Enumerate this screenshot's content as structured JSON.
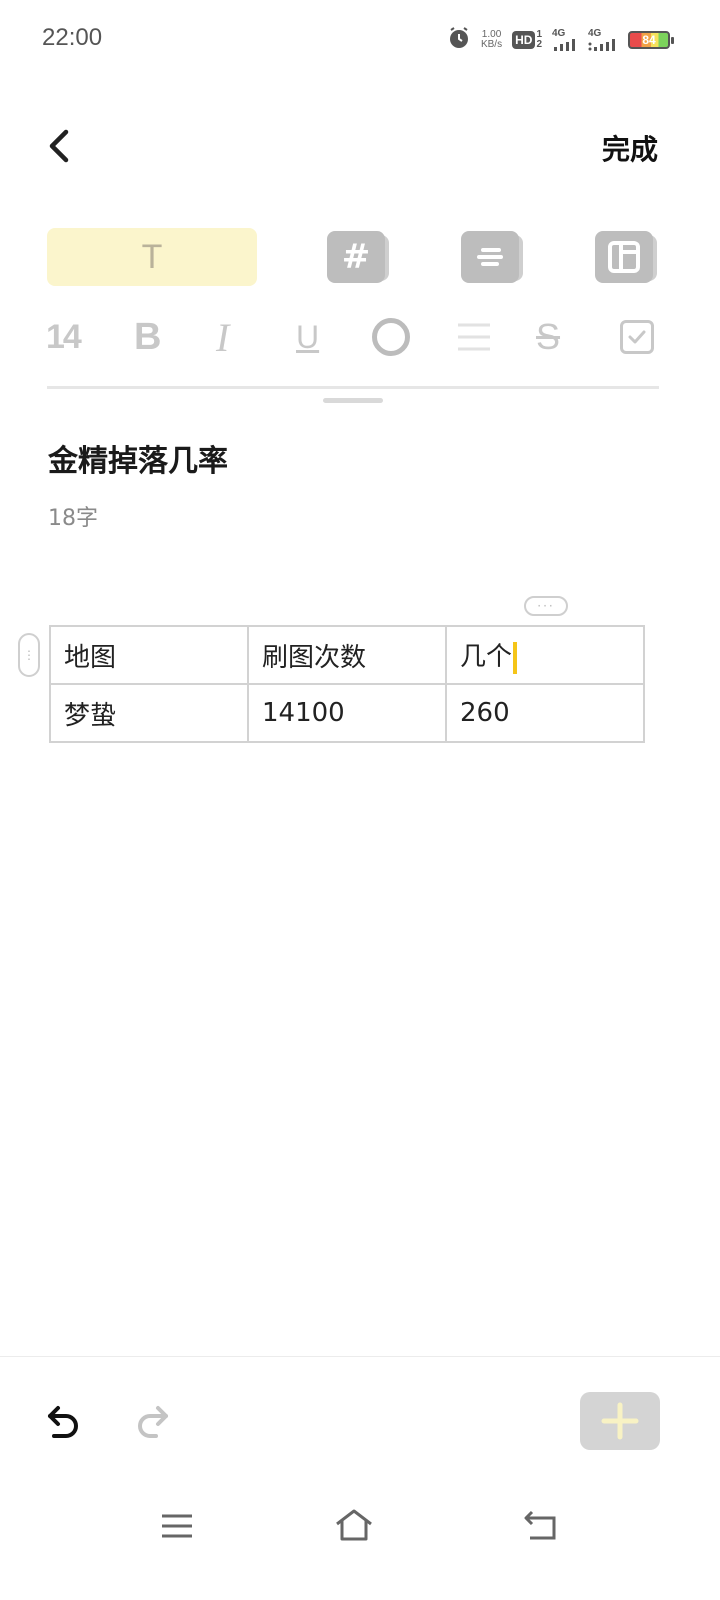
{
  "status_bar": {
    "time": "22:00",
    "net_speed_value": "1.00",
    "net_speed_unit": "KB/s",
    "hd_label": "HD",
    "hd_sim_top": "1",
    "hd_sim_bottom": "2",
    "signal_1_label": "4G",
    "signal_2_label": "4G",
    "battery_level": "84",
    "icons": [
      "alarm-icon",
      "hd-icon",
      "signal-4g-icon",
      "signal-4g-icon",
      "battery-icon"
    ]
  },
  "header": {
    "back_icon": "chevron-left-icon",
    "done_label": "完成"
  },
  "style_tabs": {
    "text_glyph": "T",
    "tag_glyph": "#",
    "icons": [
      "text-style-icon",
      "hashtag-icon",
      "list-style-icon",
      "layout-icon"
    ],
    "accent_color": "#fbf5cc"
  },
  "format_bar": {
    "font_size": "14",
    "bold": "B",
    "italic": "I",
    "underline": "U",
    "strike": "S",
    "icons": [
      "color-circle-icon",
      "align-icon",
      "checkbox-icon"
    ]
  },
  "note": {
    "title": "金精掉落几率",
    "word_count": "18字"
  },
  "table": {
    "rows": [
      [
        "地图",
        "刷图次数",
        "几个"
      ],
      [
        "梦蛰",
        "14100",
        "260"
      ]
    ],
    "cursor_color": "#f5c518"
  },
  "bottom_toolbar": {
    "add_glyph": "+",
    "icons": [
      "undo-icon",
      "redo-icon",
      "plus-icon"
    ]
  },
  "nav_bar": {
    "icons": [
      "menu-icon",
      "home-icon",
      "back-icon"
    ]
  }
}
